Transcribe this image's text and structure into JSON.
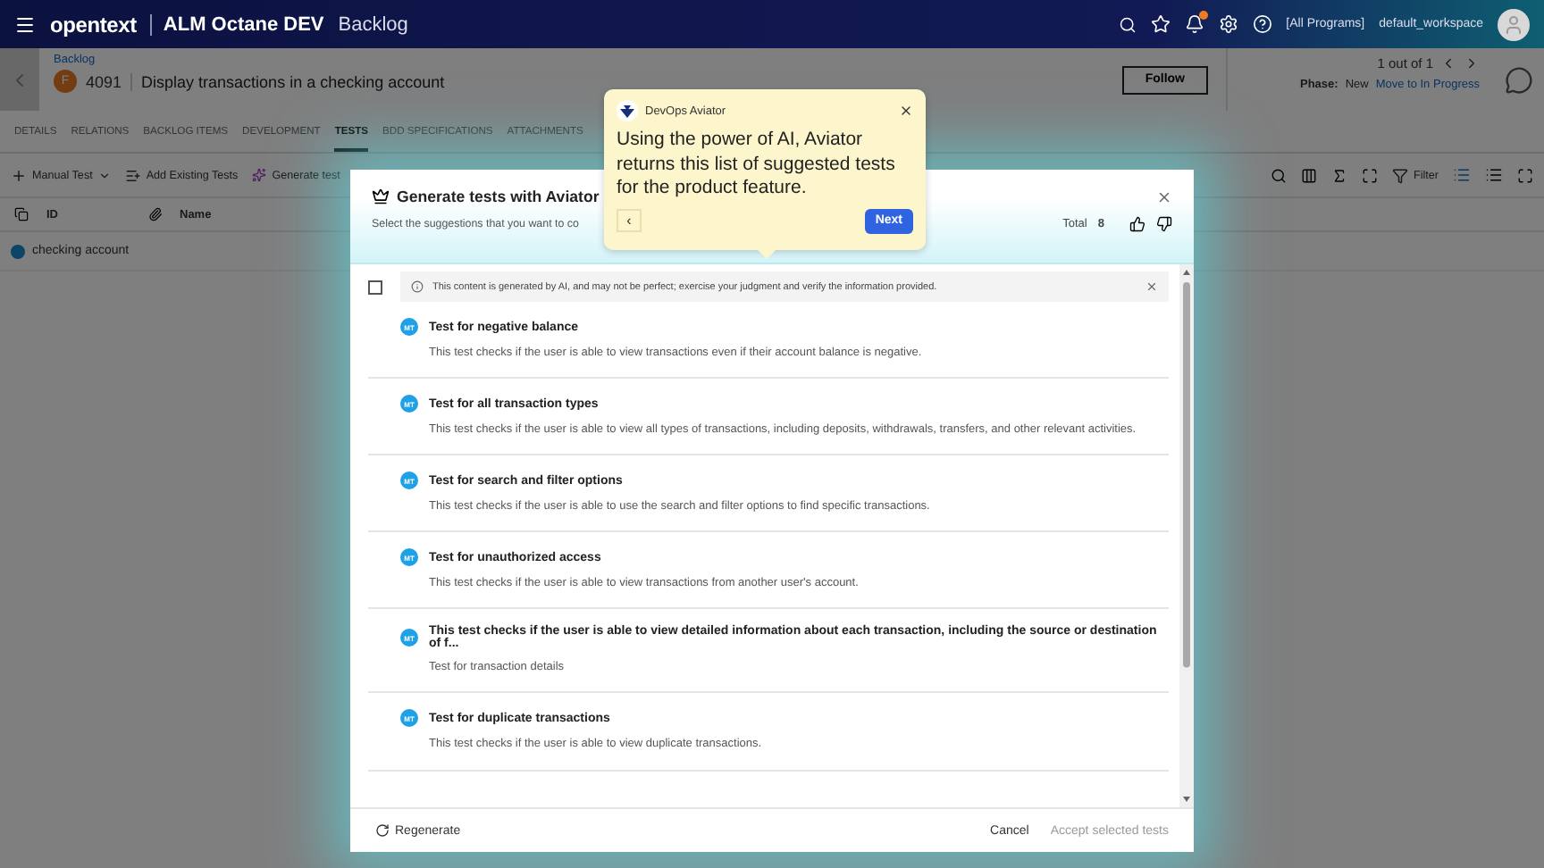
{
  "top_bar": {
    "brand": "opentext",
    "product": "ALM Octane DEV",
    "module": "Backlog",
    "notification_badge": true,
    "program": "[All Programs]",
    "workspace": "default_workspace"
  },
  "header": {
    "breadcrumb": "Backlog",
    "type_badge": "F",
    "id": "4091",
    "title": "Display transactions in a checking account",
    "follow_label": "Follow",
    "pager": "1 out of 1",
    "phase_label": "Phase:",
    "phase": "New",
    "phase_action": "Move to In Progress"
  },
  "tabs": [
    {
      "label": "DETAILS",
      "selected": false
    },
    {
      "label": "RELATIONS",
      "selected": false
    },
    {
      "label": "BACKLOG ITEMS",
      "selected": false
    },
    {
      "label": "DEVELOPMENT",
      "selected": false
    },
    {
      "label": "TESTS",
      "selected": true
    },
    {
      "label": "BDD SPECIFICATIONS",
      "selected": false
    },
    {
      "label": "ATTACHMENTS",
      "selected": false
    }
  ],
  "toolbar": {
    "manual_test": "Manual Test",
    "add_existing": "Add Existing Tests",
    "generate": "Generate test",
    "filter": "Filter"
  },
  "table": {
    "columns": [
      "ID",
      "Name"
    ],
    "rows": [
      {
        "name": "checking account"
      }
    ]
  },
  "dialog": {
    "title": "Generate tests with Aviator",
    "subtitle": "Select the suggestions that you want to co",
    "total_label": "Total",
    "total": "8",
    "select_all_checked": false,
    "notice": "This content is generated by AI, and may not be perfect; exercise your judgment and verify the information provided.",
    "suggestions": [
      {
        "badge": "MT",
        "title": "Test for negative balance",
        "description": "This test checks if the user is able to view transactions even if their account balance is negative."
      },
      {
        "badge": "MT",
        "title": "Test for all transaction types",
        "description": "This test checks if the user is able to view all types of transactions, including deposits, withdrawals, transfers, and other relevant activities."
      },
      {
        "badge": "MT",
        "title": "Test for search and filter options",
        "description": "This test checks if the user is able to use the search and filter options to find specific transactions."
      },
      {
        "badge": "MT",
        "title": "Test for unauthorized access",
        "description": "This test checks if the user is able to view transactions from another user's account."
      },
      {
        "badge": "MT",
        "title": "This test checks if the user is able to view detailed information about each transaction, including the source or destination of f...",
        "description": "Test for transaction details"
      },
      {
        "badge": "MT",
        "title": "Test for duplicate transactions",
        "description": "This test checks if the user is able to view duplicate transactions."
      }
    ],
    "regenerate": "Regenerate",
    "cancel": "Cancel",
    "accept": "Accept selected tests",
    "accept_disabled": true
  },
  "tooltip": {
    "title": "DevOps Aviator",
    "text": "Using the power of AI, Aviator returns this list of suggested tests for the product feature.",
    "back": "‹",
    "next": "Next"
  }
}
